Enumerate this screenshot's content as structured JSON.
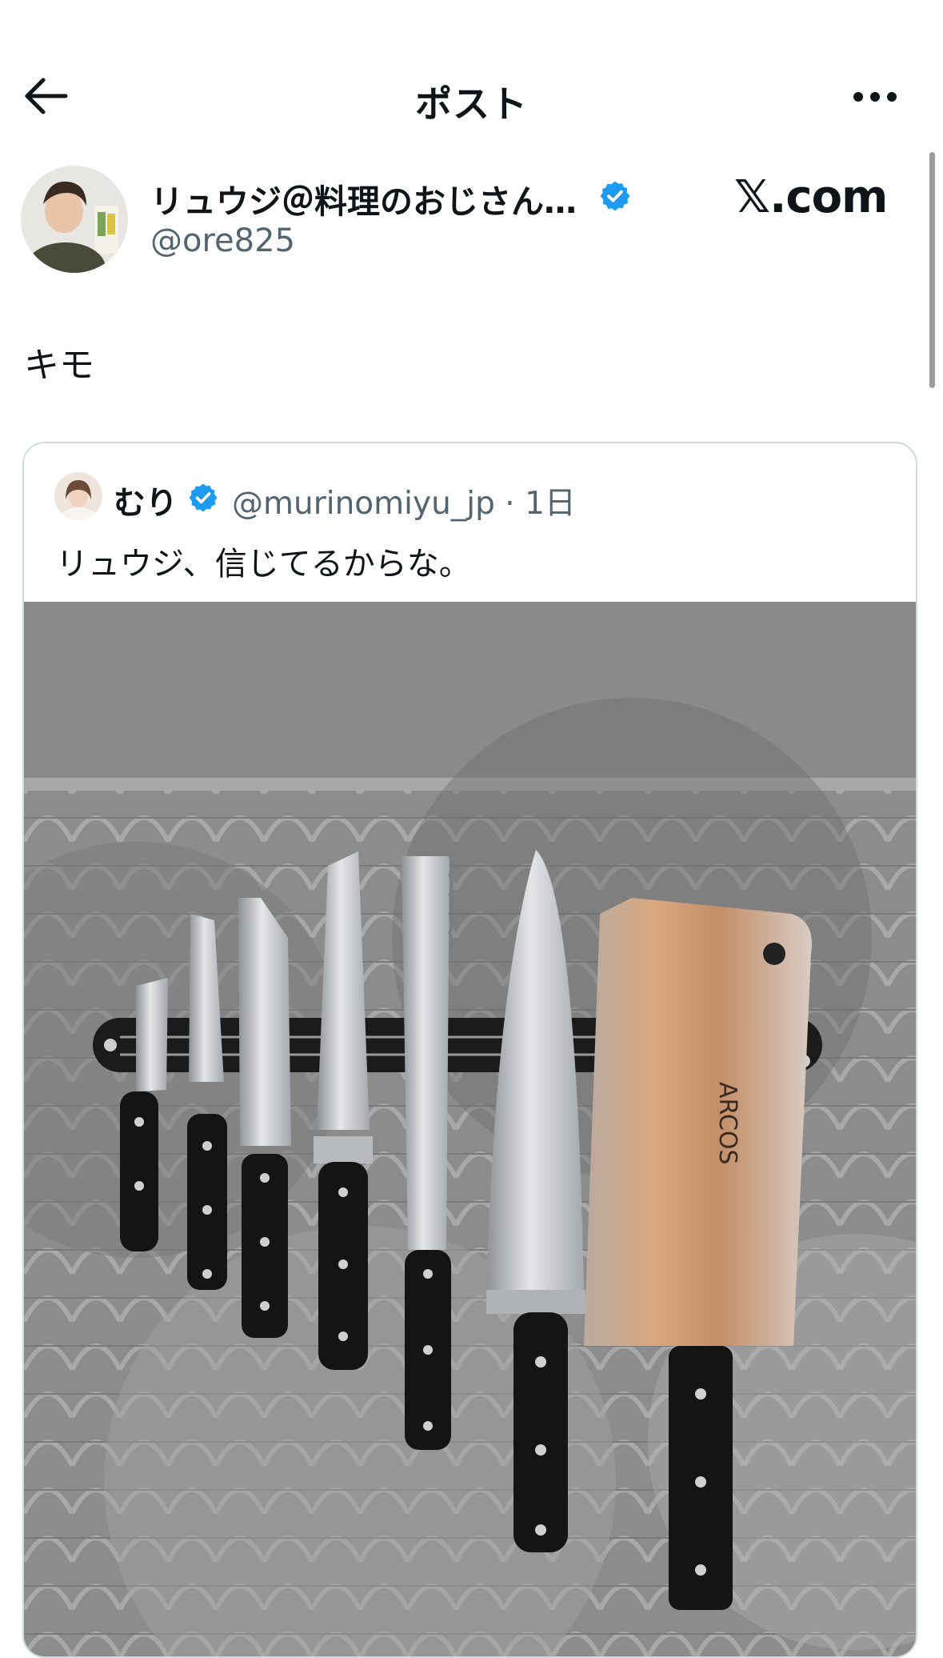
{
  "header": {
    "title": "ポスト",
    "back_icon": "arrow-left-icon",
    "more_icon": "more-horizontal-icon"
  },
  "post": {
    "author": {
      "display_name": "リュウジ＠料理のおじさん…",
      "handle": "@ore825",
      "verified": true
    },
    "watermark": "𝕏.com",
    "text": "キモ"
  },
  "quoted_post": {
    "author": {
      "display_name": "むり",
      "handle": "@murinomiyu_jp",
      "verified": true
    },
    "separator": "·",
    "time": "1日",
    "text": "リュウジ、信じてるからな。",
    "media": {
      "description": "knives on a magnetic strip over patterned carpet",
      "knife_logo": "ARCOS"
    }
  },
  "colors": {
    "verified_blue": "#1d9bf0",
    "text_primary": "#0f1419",
    "text_secondary": "#536471",
    "border": "#cfd9de"
  }
}
